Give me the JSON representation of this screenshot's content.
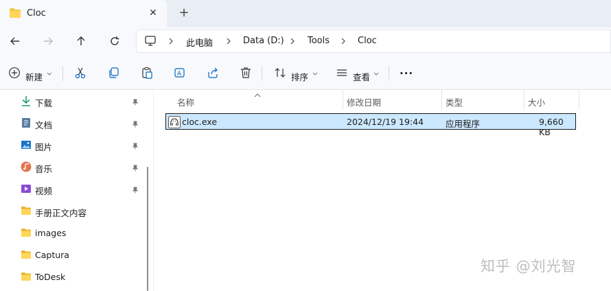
{
  "tab": {
    "title": "Cloc",
    "close": "✕",
    "new": "+"
  },
  "address": {
    "segments": [
      "此电脑",
      "Data (D:)",
      "Tools",
      "Cloc"
    ]
  },
  "toolbar": {
    "new_label": "新建",
    "sort_label": "排序",
    "view_label": "查看",
    "more": "···"
  },
  "sidebar": {
    "items": [
      {
        "label": "下载",
        "icon": "download-icon",
        "pinned": true
      },
      {
        "label": "文档",
        "icon": "document-icon",
        "pinned": true
      },
      {
        "label": "图片",
        "icon": "pictures-icon",
        "pinned": true
      },
      {
        "label": "音乐",
        "icon": "music-icon",
        "pinned": true
      },
      {
        "label": "视频",
        "icon": "video-icon",
        "pinned": true
      },
      {
        "label": "手册正文内容",
        "icon": "folder-icon",
        "pinned": false
      },
      {
        "label": "images",
        "icon": "folder-icon",
        "pinned": false
      },
      {
        "label": "Captura",
        "icon": "folder-icon",
        "pinned": false
      },
      {
        "label": "ToDesk",
        "icon": "folder-icon",
        "pinned": false
      }
    ]
  },
  "columns": {
    "name": "名称",
    "modified": "修改日期",
    "type": "类型",
    "size": "大小"
  },
  "files": [
    {
      "name": "cloc.exe",
      "modified": "2024/12/19 19:44",
      "type": "应用程序",
      "size": "9,660 KB",
      "selected": true
    }
  ],
  "watermark": "知乎 @刘光智",
  "colors": {
    "selection": "#cce8ff",
    "folder": "#f4c542",
    "accent": "#0067c0"
  }
}
